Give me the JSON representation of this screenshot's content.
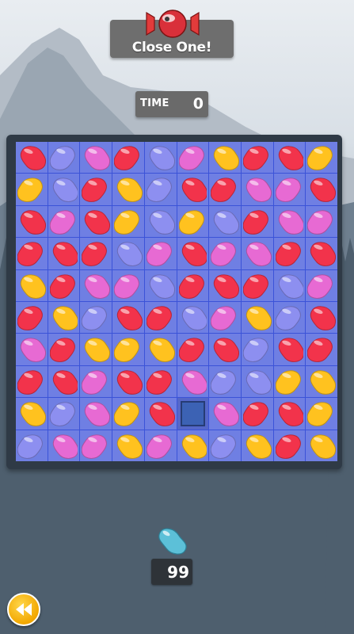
{
  "header": {
    "title": "Close One!",
    "candy_icon": "wrapped-candy-icon"
  },
  "timer": {
    "label": "TIME",
    "value": "0"
  },
  "board": {
    "rows": [
      [
        "red",
        "purple",
        "pink",
        "red",
        "purple",
        "pink",
        "yellow",
        "red",
        "red",
        "yellow"
      ],
      [
        "yellow",
        "purple",
        "red",
        "yellow",
        "purple",
        "red",
        "red",
        "pink",
        "pink",
        "red"
      ],
      [
        "red",
        "pink",
        "red",
        "yellow",
        "purple",
        "yellow",
        "purple",
        "red",
        "pink",
        "pink"
      ],
      [
        "red",
        "red",
        "red",
        "purple",
        "pink",
        "red",
        "pink",
        "pink",
        "red",
        "red"
      ],
      [
        "yellow",
        "red",
        "pink",
        "pink",
        "purple",
        "red",
        "red",
        "red",
        "purple",
        "pink"
      ],
      [
        "red",
        "yellow",
        "purple",
        "red",
        "red",
        "purple",
        "pink",
        "yellow",
        "purple",
        "red"
      ],
      [
        "pink",
        "red",
        "yellow",
        "yellow",
        "yellow",
        "red",
        "red",
        "purple",
        "red",
        "red"
      ],
      [
        "red",
        "red",
        "pink",
        "red",
        "red",
        "pink",
        "purple",
        "purple",
        "yellow",
        "yellow"
      ],
      [
        "yellow",
        "purple",
        "pink",
        "yellow",
        "red",
        "empty",
        "pink",
        "red",
        "red",
        "yellow"
      ],
      [
        "purple",
        "pink",
        "pink",
        "yellow",
        "pink",
        "yellow",
        "purple",
        "yellow",
        "red",
        "yellow"
      ]
    ],
    "colors": {
      "red": "#f2334b",
      "yellow": "#ffc21f",
      "pink": "#e76ad3",
      "purple": "#8d8ff0"
    }
  },
  "counter": {
    "icon": "blue-bean-icon",
    "value": "99"
  },
  "footer": {
    "back_icon": "rewind-icon"
  }
}
